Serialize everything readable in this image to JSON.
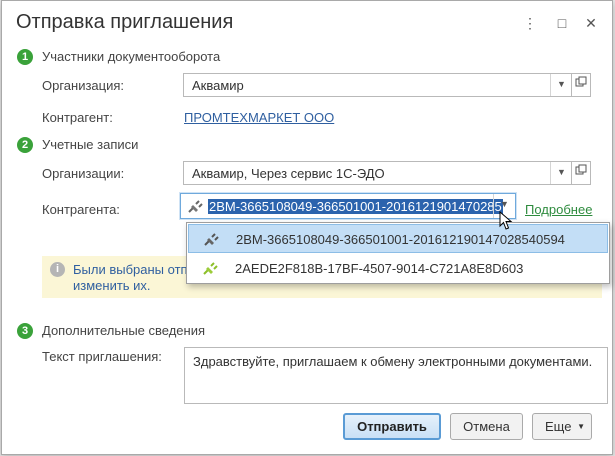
{
  "dialog": {
    "title": "Отправка приглашения",
    "controls": {
      "more": "⋮",
      "maximize": "□",
      "close": "✕"
    }
  },
  "section1": {
    "number": "1",
    "title": "Участники документооборота",
    "org_label": "Организация:",
    "org_value": "Аквамир",
    "counterparty_label": "Контрагент:",
    "counterparty_value": "ПРОМТЕХМАРКЕТ ООО"
  },
  "section2": {
    "number": "2",
    "title": "Учетные записи",
    "org_label": "Организации:",
    "org_value": "Аквамир, Через сервис 1С-ЭДО",
    "counterparty_label": "Контрагента:",
    "counterparty_value": "2BM-3665108049-366501001-2016121901470285",
    "details_link": "Подробнее"
  },
  "dropdown": {
    "items": [
      {
        "label": "2BM-3665108049-366501001-20161219014702854059​4",
        "icon": "plug-icon"
      },
      {
        "label": "2AEDE2F818B-17BF-4507-9014-C721A8E8D603",
        "icon": "plug-icon"
      }
    ]
  },
  "info": {
    "icon": "info-icon",
    "line1": "Были выбраны отп",
    "line2": "изменить их."
  },
  "section3": {
    "number": "3",
    "title": "Дополнительные сведения",
    "text_label": "Текст приглашения:",
    "text_value": "Здравствуйте, приглашаем к обмену электронными документами."
  },
  "buttons": {
    "send": "Отправить",
    "cancel": "Отмена",
    "more": "Еще"
  },
  "colors": {
    "accent_green": "#3aa23a",
    "link_blue": "#2f5fa0",
    "selection": "#2b63ad"
  }
}
